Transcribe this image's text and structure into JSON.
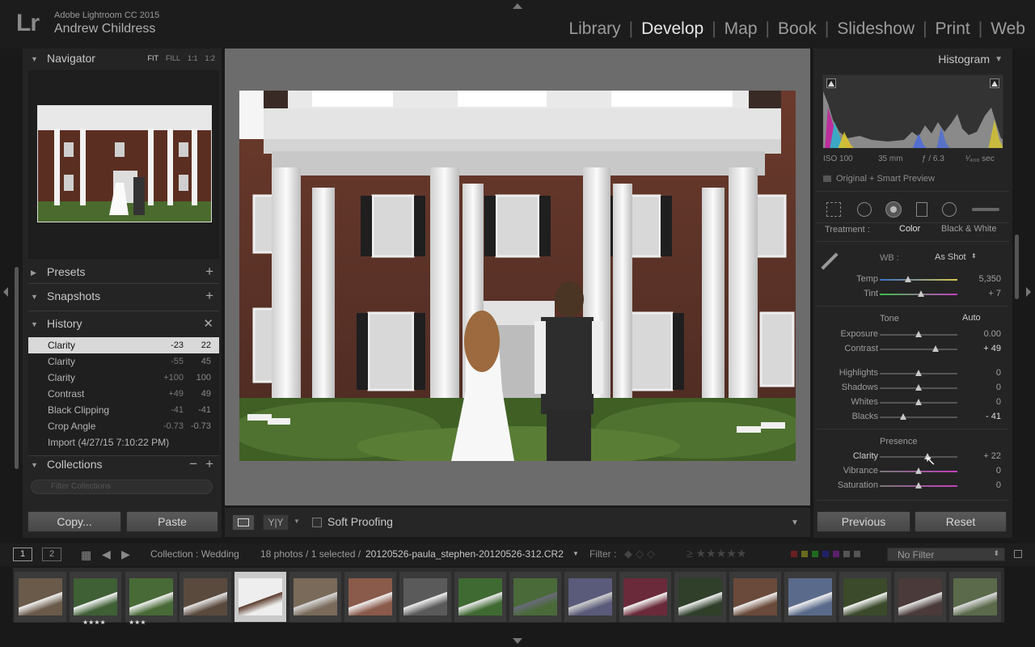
{
  "app": {
    "logo": "Lr",
    "name": "Adobe Lightroom CC 2015",
    "user": "Andrew Childress"
  },
  "modules": [
    "Library",
    "Develop",
    "Map",
    "Book",
    "Slideshow",
    "Print",
    "Web"
  ],
  "active_module": "Develop",
  "left": {
    "navigator": {
      "title": "Navigator",
      "zoom": [
        "FIT",
        "FILL",
        "1:1",
        "1:2"
      ],
      "active_zoom": "FIT"
    },
    "presets": {
      "title": "Presets"
    },
    "snapshots": {
      "title": "Snapshots"
    },
    "history": {
      "title": "History",
      "items": [
        {
          "label": "Clarity",
          "from": "-23",
          "to": "22"
        },
        {
          "label": "Clarity",
          "from": "-55",
          "to": "45"
        },
        {
          "label": "Clarity",
          "from": "+100",
          "to": "100"
        },
        {
          "label": "Contrast",
          "from": "+49",
          "to": "49"
        },
        {
          "label": "Black Clipping",
          "from": "-41",
          "to": "-41"
        },
        {
          "label": "Crop Angle",
          "from": "-0.73",
          "to": "-0.73"
        },
        {
          "label": "Import (4/27/15 7:10:22 PM)",
          "from": "",
          "to": ""
        }
      ]
    },
    "collections": {
      "title": "Collections",
      "filter_placeholder": "Filter Collections"
    },
    "copy_label": "Copy...",
    "paste_label": "Paste"
  },
  "toolbar": {
    "soft_proofing": "Soft Proofing"
  },
  "right": {
    "histogram": {
      "title": "Histogram",
      "iso": "ISO 100",
      "focal": "35 mm",
      "aperture": "ƒ / 6.3",
      "shutter": "¹⁄₄₀₀ sec",
      "preview": "Original + Smart Preview"
    },
    "treatment": {
      "label": "Treatment :",
      "color": "Color",
      "bw": "Black & White"
    },
    "wb": {
      "label": "WB :",
      "value": "As Shot"
    },
    "temp": {
      "label": "Temp",
      "value": "5,350",
      "level": 0.36
    },
    "tint": {
      "label": "Tint",
      "value": "+ 7",
      "level": 0.53
    },
    "tone": {
      "title": "Tone",
      "auto": "Auto"
    },
    "exposure": {
      "label": "Exposure",
      "value": "0.00",
      "level": 0.5
    },
    "contrast": {
      "label": "Contrast",
      "value": "+ 49",
      "level": 0.72
    },
    "highlights": {
      "label": "Highlights",
      "value": "0",
      "level": 0.5
    },
    "shadows": {
      "label": "Shadows",
      "value": "0",
      "level": 0.5
    },
    "whites": {
      "label": "Whites",
      "value": "0",
      "level": 0.5
    },
    "blacks": {
      "label": "Blacks",
      "value": "- 41",
      "level": 0.3
    },
    "presence": {
      "title": "Presence"
    },
    "clarity": {
      "label": "Clarity",
      "value": "+ 22",
      "level": 0.61
    },
    "vibrance": {
      "label": "Vibrance",
      "value": "0",
      "level": 0.5
    },
    "saturation": {
      "label": "Saturation",
      "value": "0",
      "level": 0.5
    },
    "previous_label": "Previous",
    "reset_label": "Reset"
  },
  "filmstrip_bar": {
    "page1": "1",
    "page2": "2",
    "collection": "Collection : Wedding",
    "count": "18 photos / 1 selected /",
    "filename": "20120526-paula_stephen-20120526-312.CR2",
    "filter_label": "Filter :",
    "filter_value": "No Filter"
  },
  "thumb_stars": [
    "★★★★",
    "★★★"
  ]
}
